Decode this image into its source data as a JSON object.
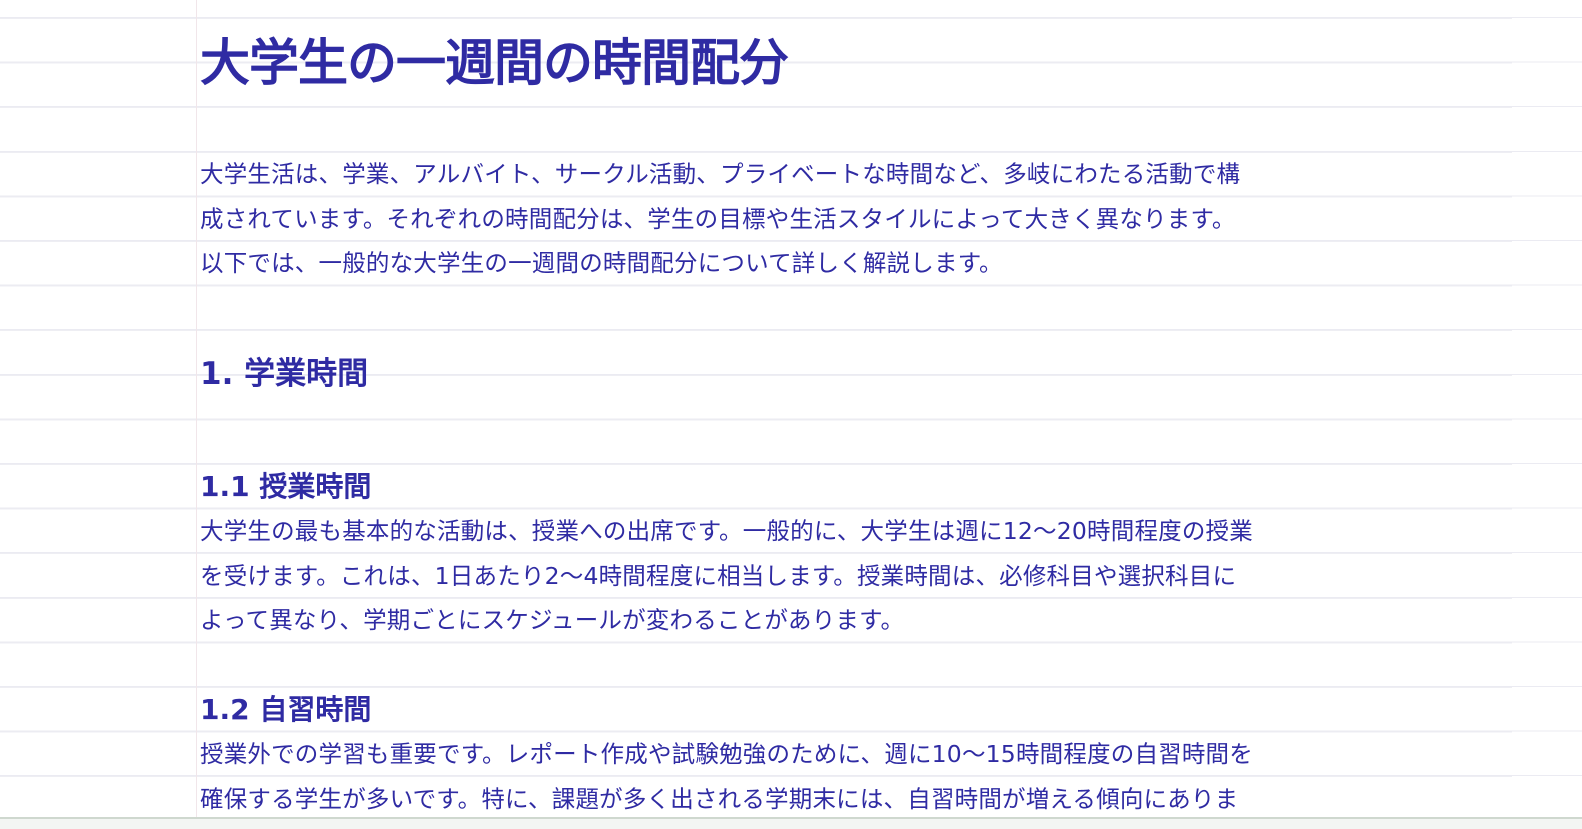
{
  "document": {
    "title": "大学生の一週間の時間配分",
    "intro": {
      "lines": [
        "大学生活は、学業、アルバイト、サークル活動、プライベートな時間など、多岐にわたる活動で構",
        "成されています。それぞれの時間配分は、学生の目標や生活スタイルによって大きく異なります。",
        "以下では、一般的な大学生の一週間の時間配分について詳しく解説します。"
      ]
    },
    "section1": {
      "heading": "1. 学業時間",
      "sub1": {
        "heading": "1.1 授業時間",
        "lines": [
          "大学生の最も基本的な活動は、授業への出席です。一般的に、大学生は週に12〜20時間程度の授業",
          "を受けます。これは、1日あたり2〜4時間程度に相当します。授業時間は、必修科目や選択科目に",
          "よって異なり、学期ごとにスケジュールが変わることがあります。"
        ]
      },
      "sub2": {
        "heading": "1.2 自習時間",
        "lines": [
          "授業外での学習も重要です。レポート作成や試験勉強のために、週に10〜15時間程度の自習時間を",
          "確保する学生が多いです。特に、課題が多く出される学期末には、自習時間が増える傾向にありま"
        ]
      }
    }
  }
}
